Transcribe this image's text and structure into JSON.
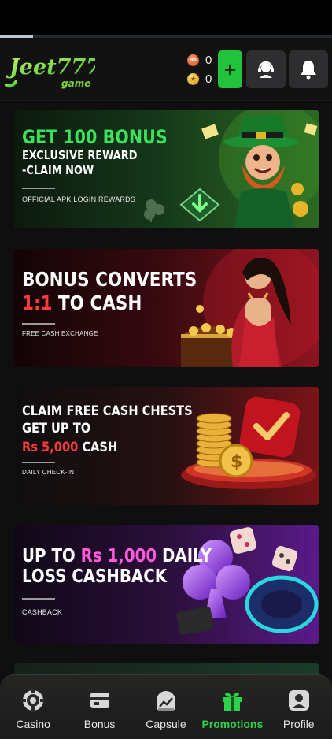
{
  "app": {
    "logo_text_main": "Jeet777",
    "logo_text_sub": "game"
  },
  "topbar": {
    "loading_progress": 0.1
  },
  "wallet": {
    "cash_symbol": "Rs",
    "cash_balance": "0",
    "gold_balance": "0"
  },
  "banners": [
    {
      "line1": "GET 100 BONUS",
      "line2": "EXCLUSIVE  REWARD",
      "line3": "-CLAIM  NOW",
      "caption": "OFFICIAL APK LOGIN REWARDS"
    },
    {
      "line1": "BONUS CONVERTS",
      "line2_accent": "1:1",
      "line2_rest": " TO CASH",
      "caption": "FREE CASH EXCHANGE"
    },
    {
      "line1": "CLAIM FREE CASH CHESTS",
      "line2": "GET UP TO",
      "line3_accent": "Rs 5,000",
      "line3_rest": " CASH",
      "caption": "DAILY CHECK-IN"
    },
    {
      "line1_a": "UP  TO ",
      "line1_accent": "Rs  1,000",
      "line1_b": "  DAILY",
      "line2": "LOSS  CASHBACK",
      "caption": "CASHBACK"
    }
  ],
  "nav": {
    "items": [
      {
        "label": "Casino",
        "icon": "chip-icon"
      },
      {
        "label": "Bonus",
        "icon": "bonus-icon"
      },
      {
        "label": "Capsule",
        "icon": "capsule-icon"
      },
      {
        "label": "Promotions",
        "icon": "gift-icon",
        "active": true
      },
      {
        "label": "Profile",
        "icon": "profile-icon"
      }
    ]
  },
  "colors": {
    "accent_green": "#22c33c",
    "active_nav": "#2fd04a",
    "accent_red": "#ff3b3b",
    "accent_pink": "#ff5ad9"
  }
}
